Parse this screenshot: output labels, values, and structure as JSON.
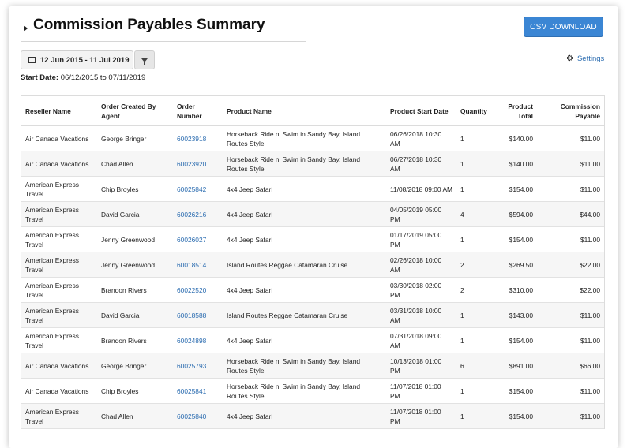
{
  "header": {
    "title": "Commission Payables Summary",
    "csv_label": "CSV DOWNLOAD"
  },
  "filters": {
    "date_range": "12 Jun 2015 - 11 Jul 2019",
    "settings_label": "Settings",
    "start_date_label": "Start Date:",
    "start_date_value": "06/12/2015 to 07/11/2019"
  },
  "table": {
    "columns": [
      "Reseller Name",
      "Order Created By Agent",
      "Order Number",
      "Product Name",
      "Product Start Date",
      "Quantity",
      "Product Total",
      "Commission Payable"
    ],
    "rows": [
      [
        "Air Canada Vacations",
        "George Bringer",
        "60023918",
        "Horseback Ride n' Swim in Sandy Bay, Island Routes Style",
        "06/26/2018 10:30 AM",
        "1",
        "$140.00",
        "$11.00"
      ],
      [
        "Air Canada Vacations",
        "Chad Allen",
        "60023920",
        "Horseback Ride n' Swim in Sandy Bay, Island Routes Style",
        "06/27/2018 10:30 AM",
        "1",
        "$140.00",
        "$11.00"
      ],
      [
        "American Express Travel",
        "Chip Broyles",
        "60025842",
        "4x4 Jeep Safari",
        "11/08/2018 09:00 AM",
        "1",
        "$154.00",
        "$11.00"
      ],
      [
        "American Express Travel",
        "David Garcia",
        "60026216",
        "4x4 Jeep Safari",
        "04/05/2019 05:00 PM",
        "4",
        "$594.00",
        "$44.00"
      ],
      [
        "American Express Travel",
        "Jenny Greenwood",
        "60026027",
        "4x4 Jeep Safari",
        "01/17/2019 05:00 PM",
        "1",
        "$154.00",
        "$11.00"
      ],
      [
        "American Express Travel",
        "Jenny Greenwood",
        "60018514",
        "Island Routes Reggae Catamaran Cruise",
        "02/26/2018 10:00 AM",
        "2",
        "$269.50",
        "$22.00"
      ],
      [
        "American Express Travel",
        "Brandon Rivers",
        "60022520",
        "4x4 Jeep Safari",
        "03/30/2018 02:00 PM",
        "2",
        "$310.00",
        "$22.00"
      ],
      [
        "American Express Travel",
        "David Garcia",
        "60018588",
        "Island Routes Reggae Catamaran Cruise",
        "03/31/2018 10:00 AM",
        "1",
        "$143.00",
        "$11.00"
      ],
      [
        "American Express Travel",
        "Brandon Rivers",
        "60024898",
        "4x4 Jeep Safari",
        "07/31/2018 09:00 AM",
        "1",
        "$154.00",
        "$11.00"
      ],
      [
        "Air Canada Vacations",
        "George Bringer",
        "60025793",
        "Horseback Ride n' Swim in Sandy Bay, Island Routes Style",
        "10/13/2018 01:00 PM",
        "6",
        "$891.00",
        "$66.00"
      ],
      [
        "Air Canada Vacations",
        "Chip Broyles",
        "60025841",
        "Horseback Ride n' Swim in Sandy Bay, Island Routes Style",
        "11/07/2018 01:00 PM",
        "1",
        "$154.00",
        "$11.00"
      ],
      [
        "American Express Travel",
        "Chad Allen",
        "60025840",
        "4x4 Jeep Safari",
        "11/07/2018 01:00 PM",
        "1",
        "$154.00",
        "$11.00"
      ]
    ]
  },
  "icons": {
    "caret": "caret-right-icon",
    "calendar": "calendar-icon",
    "filter": "filter-icon",
    "settings": "gear-icon"
  },
  "colors": {
    "accent": "#3b86d4",
    "link": "#2b6cb0"
  }
}
